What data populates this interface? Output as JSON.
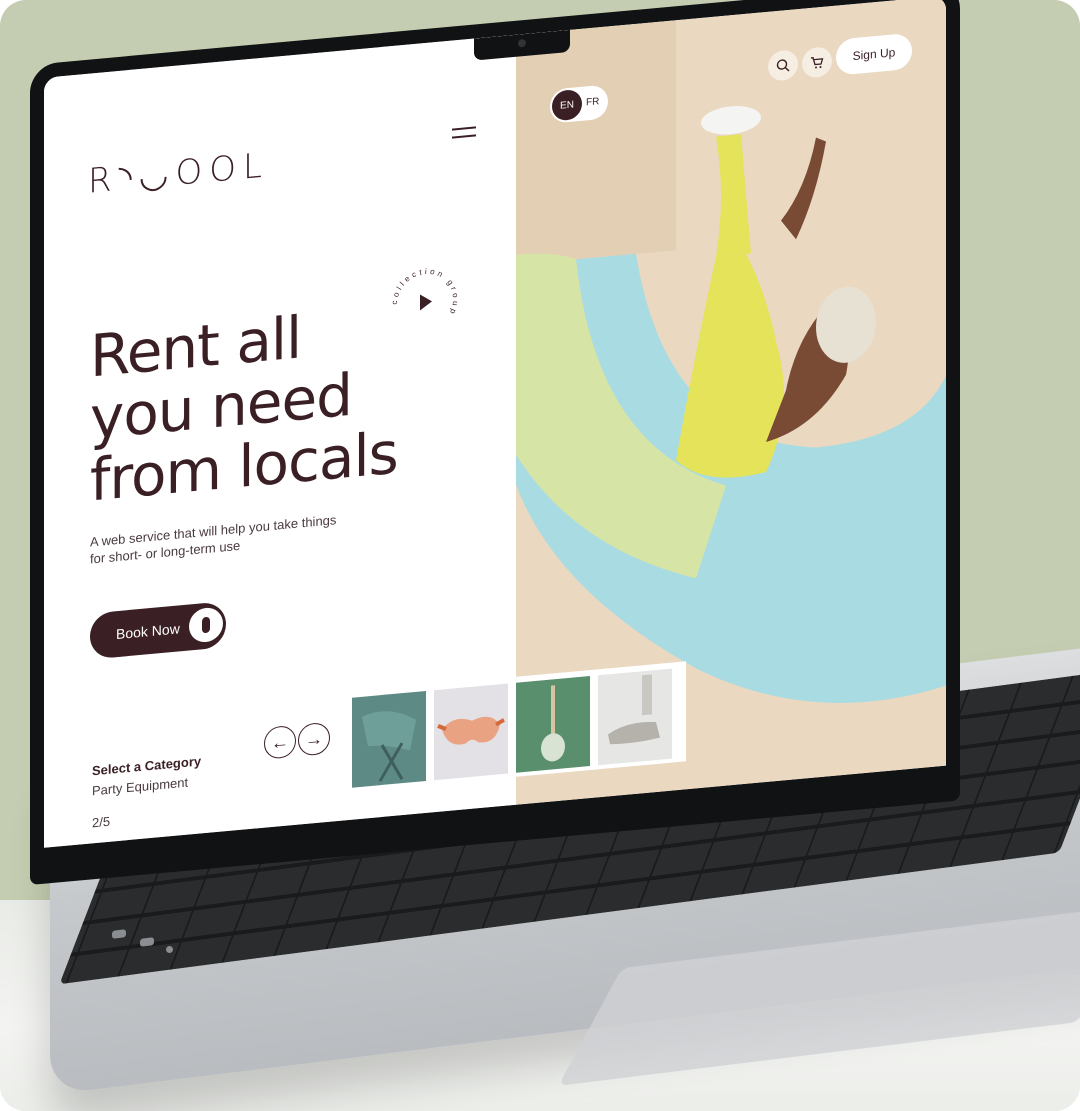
{
  "brand": {
    "logo_text": "R◝◡OOL"
  },
  "header": {
    "lang_active": "EN",
    "lang_other": "FR",
    "signup_label": "Sign Up"
  },
  "hero": {
    "headline_lines": [
      "Rent all",
      "you need",
      "from locals"
    ],
    "subtext": "A web service that will help you take things for short- or long-term use",
    "book_label": "Book Now",
    "collection_text": "collection group"
  },
  "category": {
    "title": "Select a Category",
    "value": "Party Equipment",
    "page": "2/5"
  },
  "colors": {
    "brand_dark": "#3a1f24",
    "background_sage": "#c4cdb1",
    "hero_beige": "#ead8c0",
    "hero_blue": "#a9dbe3",
    "hero_yellow": "#e4e35a"
  },
  "icons": [
    "menu-icon",
    "play-icon",
    "search-icon",
    "cart-icon",
    "arrow-left-icon",
    "arrow-right-icon"
  ]
}
